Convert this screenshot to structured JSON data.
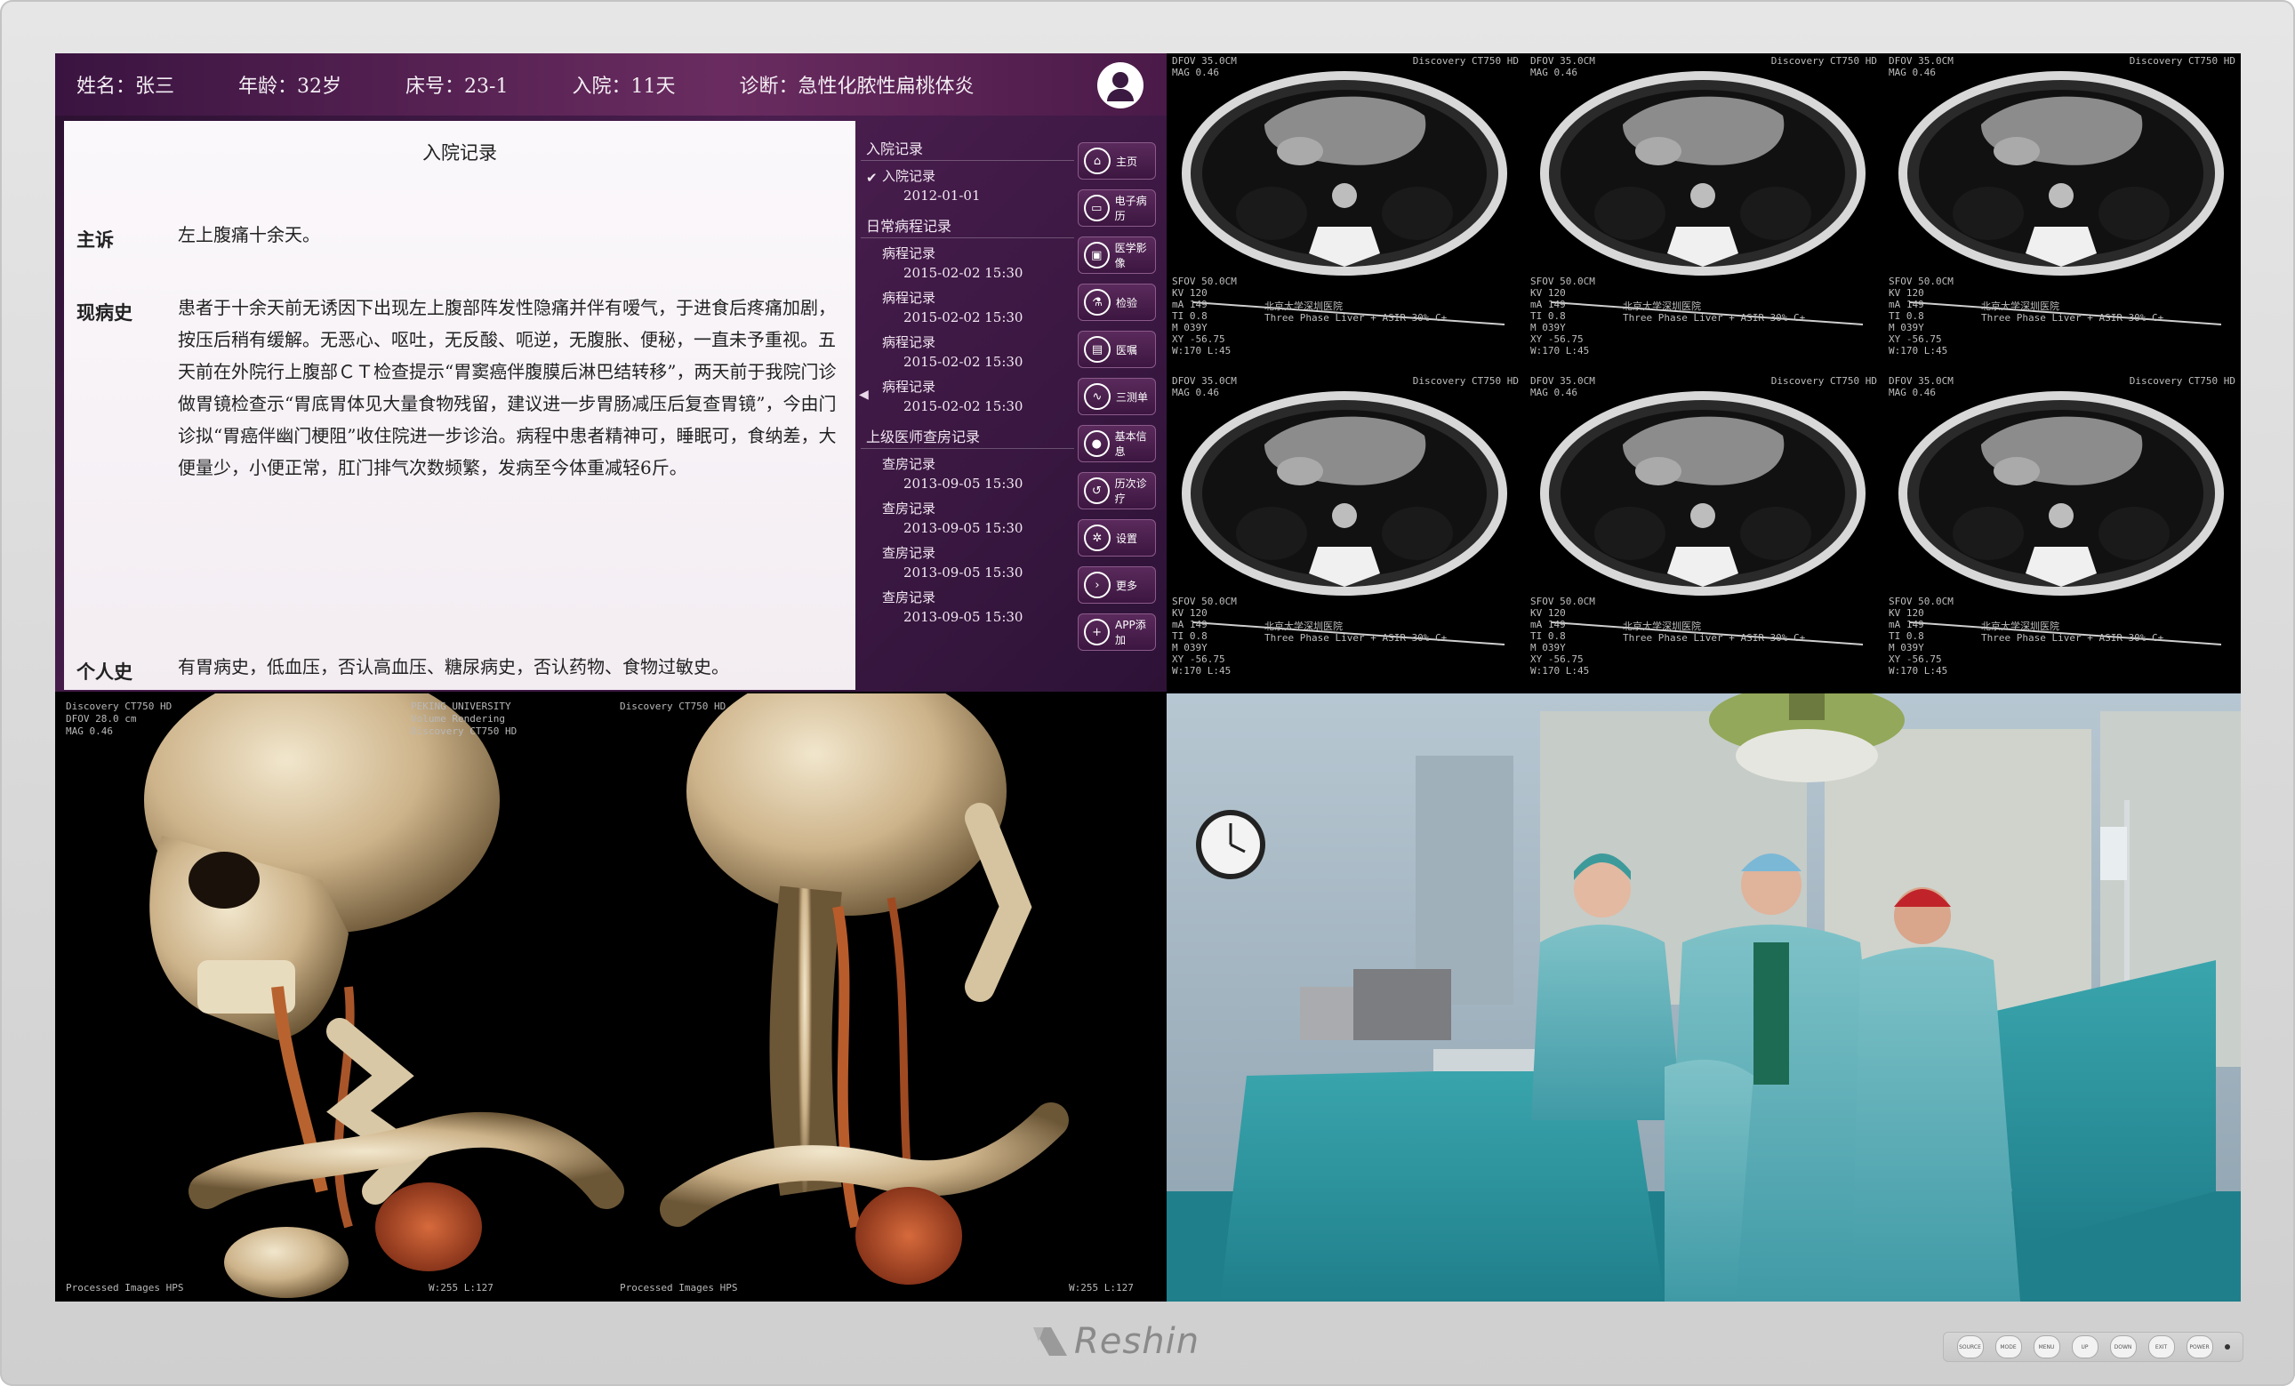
{
  "brand": "Reshin",
  "patient_header": {
    "name": "姓名：张三",
    "age": "年龄：32岁",
    "bed": "床号：23-1",
    "admission": "入院：11天",
    "diagnosis": "诊断：急性化脓性扁桃体炎"
  },
  "document": {
    "title": "入院记录",
    "chief_complaint_label": "主诉",
    "chief_complaint": "左上腹痛十余天。",
    "present_illness_label": "现病史",
    "present_illness": "患者于十余天前无诱因下出现左上腹部阵发性隐痛并伴有嗳气，于进食后疼痛加剧，按压后稍有缓解。无恶心、呕吐，无反酸、呃逆，无腹胀、便秘，一直未予重视。五天前在外院行上腹部ＣＴ检查提示“胃窦癌伴腹膜后淋巴结转移”，两天前于我院门诊做胃镜检查示“胃底胃体见大量食物残留，建议进一步胃肠减压后复查胃镜”，今由门诊拟“胃癌伴幽门梗阻”收住院进一步诊治。病程中患者精神可，睡眠可，食纳差，大便量少，小便正常，肛门排气次数频繁，发病至今体重减轻6斤。",
    "personal_history_label": "个人史",
    "personal_history": "有胃病史，低血压，否认高血压、糖尿病史，否认药物、食物过敏史。"
  },
  "records": {
    "sections": [
      {
        "title": "入院记录",
        "items": [
          {
            "label": "入院记录",
            "date": "2012-01-01",
            "selected": true
          }
        ]
      },
      {
        "title": "日常病程记录",
        "items": [
          {
            "label": "病程记录",
            "date": "2015-02-02 15:30"
          },
          {
            "label": "病程记录",
            "date": "2015-02-02 15:30"
          },
          {
            "label": "病程记录",
            "date": "2015-02-02 15:30"
          },
          {
            "label": "病程记录",
            "date": "2015-02-02 15:30"
          }
        ]
      },
      {
        "title": "上级医师查房记录",
        "items": [
          {
            "label": "查房记录",
            "date": "2013-09-05 15:30"
          },
          {
            "label": "查房记录",
            "date": "2013-09-05 15:30"
          },
          {
            "label": "查房记录",
            "date": "2013-09-05 15:30"
          },
          {
            "label": "查房记录",
            "date": "2013-09-05 15:30"
          }
        ]
      }
    ]
  },
  "nav_buttons": [
    {
      "label": "主页",
      "icon": "home-icon"
    },
    {
      "label": "电子病历",
      "icon": "folder-icon"
    },
    {
      "label": "医学影像",
      "icon": "image-icon"
    },
    {
      "label": "检验",
      "icon": "flask-icon"
    },
    {
      "label": "医嘱",
      "icon": "clipboard-icon"
    },
    {
      "label": "三测单",
      "icon": "chart-icon"
    },
    {
      "label": "基本信息",
      "icon": "user-icon"
    },
    {
      "label": "历次诊疗",
      "icon": "history-icon"
    },
    {
      "label": "设置",
      "icon": "gear-icon"
    },
    {
      "label": "更多",
      "icon": "chevron-right-icon"
    },
    {
      "label": "APP添加",
      "icon": "plus-icon"
    }
  ],
  "ct_overlay": {
    "scanner": "Discovery CT750 HD",
    "hospital": "北京大学深圳医院",
    "protocol": "Three Phase Liver + ASIR 30% C+",
    "top_lines": [
      "DFOV 35.0CM",
      "MAG 0.46"
    ],
    "params": [
      "SFOV 50.0CM",
      "KV 120",
      "mA 149",
      "TI 0.8",
      "M 039Y",
      "XY -56.75",
      "W:170 L:45"
    ]
  },
  "recon_overlay": {
    "institution": "PEKING UNIVERSITY",
    "series": "Volume Rendering",
    "scanner": "Discovery CT750 HD",
    "footer": "Processed Images HPS",
    "window": "W:255 L:127"
  },
  "control_panel": {
    "buttons": [
      "SOURCE",
      "MODE",
      "MENU",
      "UP",
      "DOWN",
      "EXIT",
      "POWER"
    ]
  }
}
